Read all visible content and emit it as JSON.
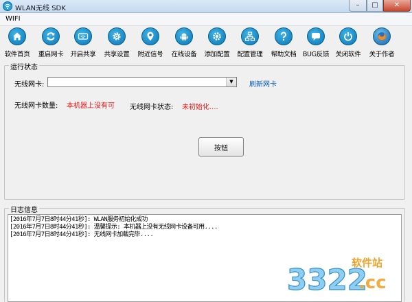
{
  "window": {
    "title": "WLAN无线 SDK",
    "minimize": "–",
    "maximize": "□",
    "close": "✕"
  },
  "menu": {
    "items": [
      "WIFI"
    ]
  },
  "toolbar": {
    "items": [
      {
        "label": "软件首页",
        "icon": "home-icon"
      },
      {
        "label": "重启网卡",
        "icon": "refresh-icon"
      },
      {
        "label": "开启共享",
        "icon": "wifi-icon"
      },
      {
        "label": "共享设置",
        "icon": "gear-icon"
      },
      {
        "label": "附近信号",
        "icon": "location-pin-icon"
      },
      {
        "label": "在线设备",
        "icon": "android-icon"
      },
      {
        "label": "添加配置",
        "icon": "gear-add-icon"
      },
      {
        "label": "配置管理",
        "icon": "network-icon"
      },
      {
        "label": "帮助文档",
        "icon": "question-icon"
      },
      {
        "label": "BUG反馈",
        "icon": "chat-icon"
      },
      {
        "label": "关闭软件",
        "icon": "power-icon"
      },
      {
        "label": "关于作者",
        "icon": "firefox-icon"
      }
    ]
  },
  "status_group": {
    "title": "运行状态",
    "adapter_label": "无线网卡:",
    "adapter_value": "",
    "refresh_link": "刷新网卡",
    "count_label": "无线网卡数量:",
    "count_value": "本机器上没有可",
    "state_label": "无线网卡状态:",
    "state_value": "未初始化....",
    "button_label": "按钮"
  },
  "log_group": {
    "title": "日志信息",
    "lines": [
      "[2016年7月7日8时44分41秒]: WLAN服务初始化成功",
      "[2016年7月7日8时44分41秒]: 温馨提示: 本机器上没有无线网卡设备可用....",
      "[2016年7月7日8时44分41秒]: 无线网卡加载完毕...."
    ]
  },
  "watermark": {
    "site": "软件站",
    "number": "3322",
    "domain": ".cc"
  },
  "colors": {
    "accent": "#0a76b5",
    "error_text": "#e01b1b",
    "link": "#0b5fb3"
  }
}
